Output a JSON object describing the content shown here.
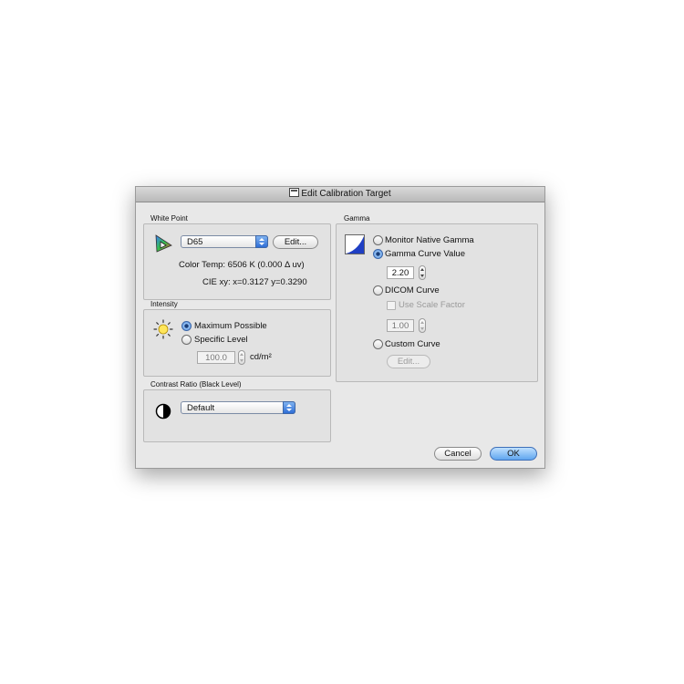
{
  "window": {
    "title": "Edit Calibration Target"
  },
  "white_point": {
    "label": "White Point",
    "selected": "D65",
    "edit_label": "Edit...",
    "color_temp": "Color Temp: 6506 K (0.000 Δ uv)",
    "cie": "CIE xy: x=0.3127 y=0.3290"
  },
  "intensity": {
    "label": "Intensity",
    "options": [
      "Maximum Possible",
      "Specific Level"
    ],
    "selected_index": 0,
    "level_value": "100.0",
    "level_unit": "cd/m²"
  },
  "contrast": {
    "label": "Contrast Ratio (Black Level)",
    "selected": "Default"
  },
  "gamma": {
    "label": "Gamma",
    "opt_native": "Monitor Native Gamma",
    "opt_curve": "Gamma Curve Value",
    "curve_value": "2.20",
    "opt_dicom": "DICOM Curve",
    "use_scale": "Use Scale Factor",
    "scale_value": "1.00",
    "opt_custom": "Custom Curve",
    "edit_label": "Edit..."
  },
  "buttons": {
    "cancel": "Cancel",
    "ok": "OK"
  }
}
